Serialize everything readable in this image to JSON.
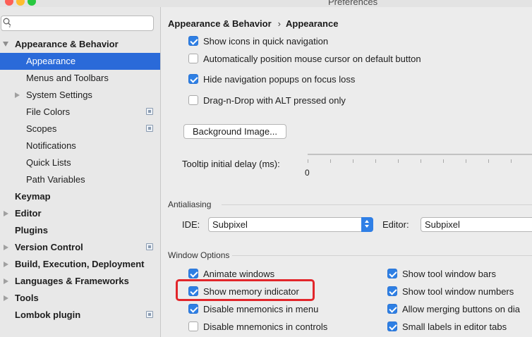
{
  "window": {
    "title": "Preferences",
    "traffic_colors": [
      "#fd5f57",
      "#febc2e",
      "#28c840"
    ]
  },
  "sidebar": {
    "search": {
      "value": "",
      "placeholder": ""
    },
    "items": [
      {
        "label": "Appearance & Behavior",
        "bold": true,
        "arrow": "down",
        "selected": false
      },
      {
        "label": "Appearance",
        "bold": false,
        "arrow": "",
        "selected": true
      },
      {
        "label": "Menus and Toolbars",
        "bold": false,
        "arrow": "",
        "selected": false
      },
      {
        "label": "System Settings",
        "bold": false,
        "arrow": "right",
        "selected": false
      },
      {
        "label": "File Colors",
        "bold": false,
        "arrow": "",
        "selected": false,
        "project_icon": true
      },
      {
        "label": "Scopes",
        "bold": false,
        "arrow": "",
        "selected": false,
        "project_icon": true
      },
      {
        "label": "Notifications",
        "bold": false,
        "arrow": "",
        "selected": false
      },
      {
        "label": "Quick Lists",
        "bold": false,
        "arrow": "",
        "selected": false
      },
      {
        "label": "Path Variables",
        "bold": false,
        "arrow": "",
        "selected": false
      },
      {
        "label": "Keymap",
        "bold": true,
        "arrow": "",
        "selected": false
      },
      {
        "label": "Editor",
        "bold": true,
        "arrow": "right",
        "selected": false
      },
      {
        "label": "Plugins",
        "bold": true,
        "arrow": "",
        "selected": false
      },
      {
        "label": "Version Control",
        "bold": true,
        "arrow": "right",
        "selected": false,
        "project_icon": true
      },
      {
        "label": "Build, Execution, Deployment",
        "bold": true,
        "arrow": "right",
        "selected": false
      },
      {
        "label": "Languages & Frameworks",
        "bold": true,
        "arrow": "right",
        "selected": false
      },
      {
        "label": "Tools",
        "bold": true,
        "arrow": "right",
        "selected": false
      },
      {
        "label": "Lombok plugin",
        "bold": true,
        "arrow": "",
        "selected": false,
        "project_icon": true
      }
    ]
  },
  "main": {
    "breadcrumb": {
      "parent": "Appearance & Behavior",
      "separator": "›",
      "current": "Appearance"
    },
    "checkboxes_top": [
      {
        "label": "Show icons in quick navigation",
        "checked": true
      },
      {
        "label": "Automatically position mouse cursor on default button",
        "checked": false
      },
      {
        "label": "Hide navigation popups on focus loss",
        "checked": true
      },
      {
        "label": "Drag-n-Drop with ALT pressed only",
        "checked": false
      }
    ],
    "background_button": "Background Image...",
    "tooltip": {
      "label": "Tooltip initial delay (ms):",
      "min_label": "0"
    },
    "antialiasing": {
      "title": "Antialiasing",
      "ide_label": "IDE:",
      "ide_value": "Subpixel",
      "editor_label": "Editor:",
      "editor_value": "Subpixel"
    },
    "window_options": {
      "title": "Window Options",
      "left": [
        {
          "label": "Animate windows",
          "checked": true
        },
        {
          "label": "Show memory indicator",
          "checked": true
        },
        {
          "label": "Disable mnemonics in menu",
          "checked": true
        },
        {
          "label": "Disable mnemonics in controls",
          "checked": false
        }
      ],
      "right": [
        {
          "label": "Show tool window bars",
          "checked": true
        },
        {
          "label": "Show tool window numbers",
          "checked": true
        },
        {
          "label": "Allow merging buttons on dia",
          "checked": true
        },
        {
          "label": "Small labels in editor tabs",
          "checked": true
        }
      ]
    },
    "accent_color": "#2e7fe4",
    "highlight_color": "#e2262b"
  }
}
